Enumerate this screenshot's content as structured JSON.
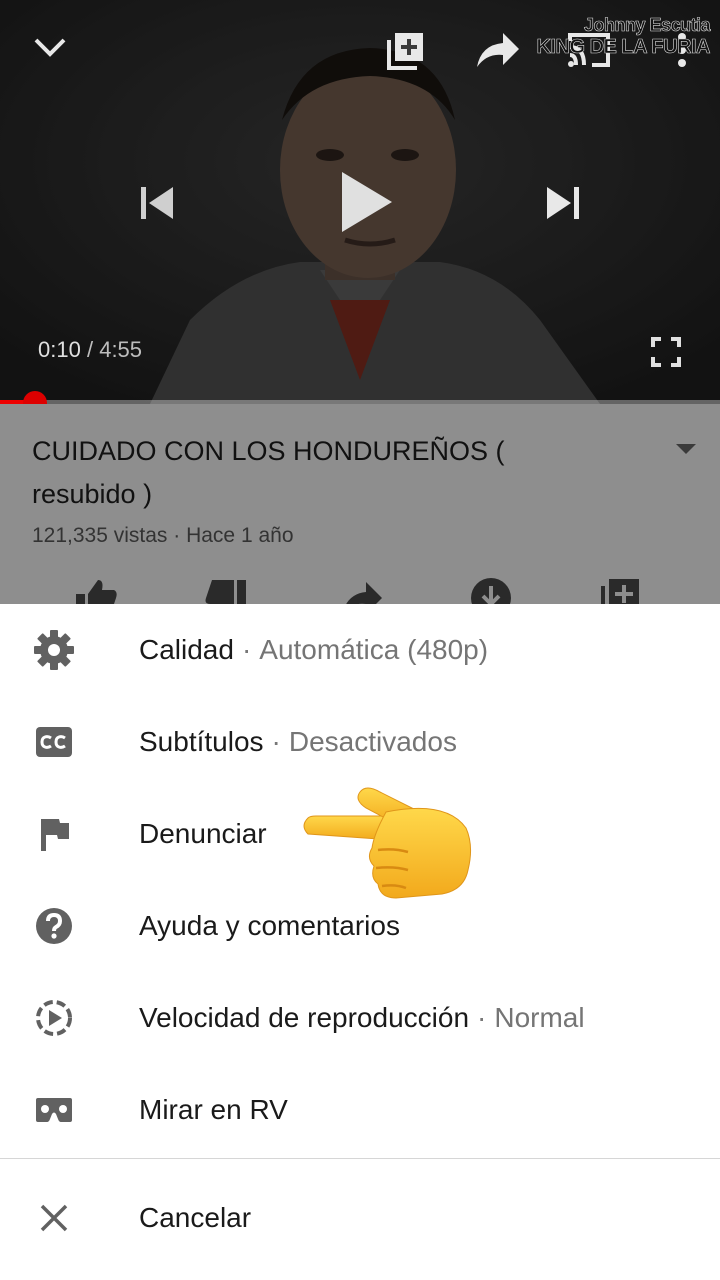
{
  "player": {
    "watermark_line1": "Johnny Escutia",
    "watermark_line2": "KING DE LA FURIA",
    "current_time": "0:10",
    "separator": "/",
    "duration": "4:55",
    "progress_fraction": 0.049,
    "icons": [
      "chevron-down-icon",
      "add-to-playlist-icon",
      "share-icon",
      "cast-icon",
      "more-vert-icon",
      "previous-icon",
      "play-icon",
      "next-icon",
      "fullscreen-icon"
    ]
  },
  "video": {
    "title": "CUIDADO CON LOS HONDUREÑOS ( resubido )",
    "meta": "121,335 vistas · Hace 1 año",
    "actions": [
      "like-icon",
      "dislike-icon",
      "share-icon",
      "download-icon",
      "save-icon"
    ]
  },
  "menu": {
    "items": [
      {
        "label": "Calidad",
        "value": "Automática (480p)",
        "icon": "gear-icon"
      },
      {
        "label": "Subtítulos",
        "value": "Desactivados",
        "icon": "cc-icon"
      },
      {
        "label": "Denunciar",
        "value": "",
        "icon": "flag-icon"
      },
      {
        "label": "Ayuda y comentarios",
        "value": "",
        "icon": "help-icon"
      },
      {
        "label": "Velocidad de reproducción",
        "value": "Normal",
        "icon": "playback-speed-icon"
      },
      {
        "label": "Mirar en RV",
        "value": "",
        "icon": "vr-icon"
      }
    ],
    "cancel": {
      "label": "Cancelar",
      "icon": "close-icon"
    },
    "value_separator": "·"
  },
  "colors": {
    "progress": "#ee0000",
    "sheet_bg": "#ffffff",
    "dim_overlay": "#8e8e8e"
  }
}
